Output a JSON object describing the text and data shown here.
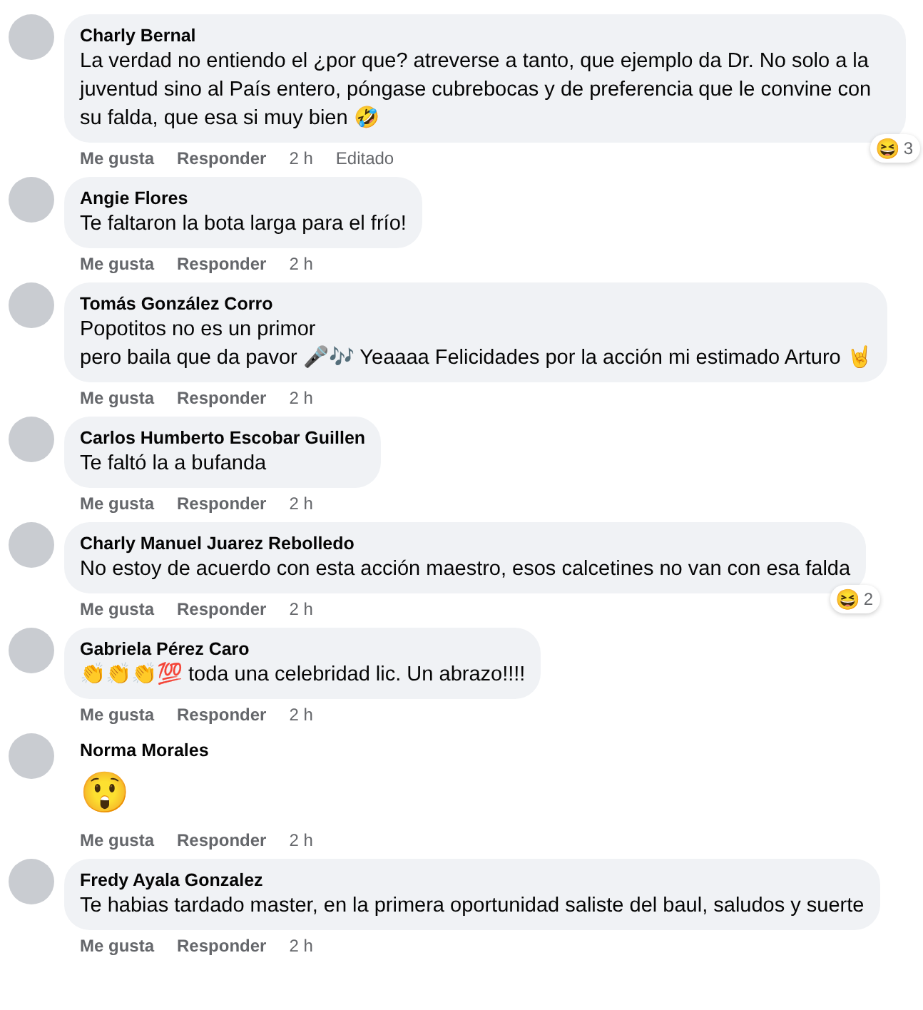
{
  "comments": [
    {
      "author": "Charly Bernal",
      "text": "La verdad no entiendo el ¿por que? atreverse a tanto, que ejemplo da Dr. No solo a la juventud sino al País entero, póngase cubrebocas y de preferencia que le convine con su falda, que esa si muy bien 🤣",
      "kind": "text",
      "reaction": {
        "emoji": "😆",
        "count": "3"
      },
      "actions": [
        "Me gusta",
        "Responder"
      ],
      "time": "2 h",
      "edited": "Editado"
    },
    {
      "author": "Angie Flores",
      "text": "Te faltaron la bota larga para el frío!",
      "kind": "text",
      "actions": [
        "Me gusta",
        "Responder"
      ],
      "time": "2 h"
    },
    {
      "author": "Tomás González Corro",
      "text": "Popotitos no es un primor\npero baila que da pavor 🎤🎶 Yeaaaa Felicidades por la acción mi estimado Arturo 🤘",
      "kind": "text",
      "actions": [
        "Me gusta",
        "Responder"
      ],
      "time": "2 h"
    },
    {
      "author": "Carlos Humberto Escobar Guillen",
      "text": "Te faltó la a bufanda",
      "kind": "text",
      "actions": [
        "Me gusta",
        "Responder"
      ],
      "time": "2 h"
    },
    {
      "author": "Charly Manuel Juarez Rebolledo",
      "text": "No estoy de acuerdo con esta acción maestro, esos calcetines no van con esa falda",
      "kind": "text",
      "reaction": {
        "emoji": "😆",
        "count": "2"
      },
      "actions": [
        "Me gusta",
        "Responder"
      ],
      "time": "2 h"
    },
    {
      "author": "Gabriela Pérez Caro",
      "text": "👏👏👏💯 toda una celebridad lic. Un abrazo!!!!",
      "kind": "text",
      "actions": [
        "Me gusta",
        "Responder"
      ],
      "time": "2 h"
    },
    {
      "author": "Norma Morales",
      "text": "😲",
      "kind": "emoji",
      "actions": [
        "Me gusta",
        "Responder"
      ],
      "time": "2 h"
    },
    {
      "author": "Fredy Ayala Gonzalez",
      "text": "Te habias tardado master, en la primera oportunidad saliste del baul, saludos y suerte",
      "kind": "text",
      "actions": [
        "Me gusta",
        "Responder"
      ],
      "time": "2 h"
    }
  ]
}
